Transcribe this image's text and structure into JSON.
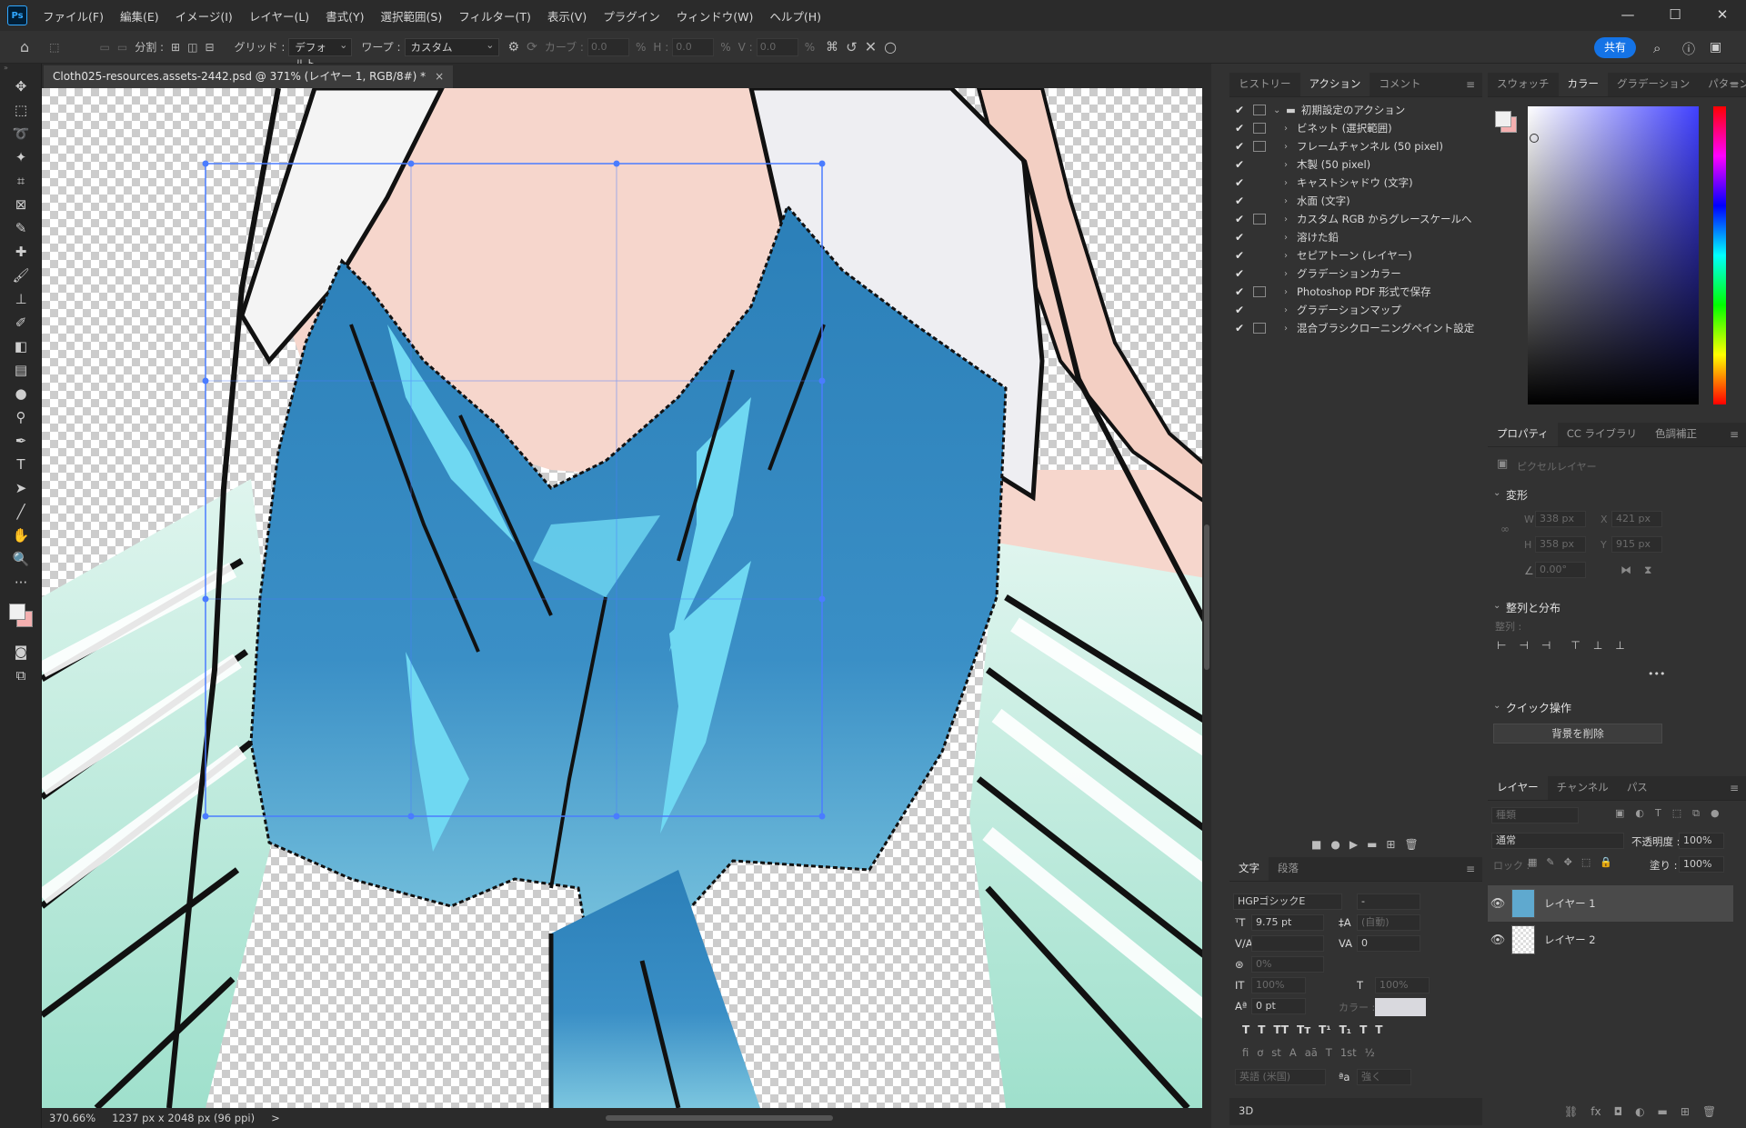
{
  "app": {
    "logo": "Ps"
  },
  "menu": [
    "ファイル(F)",
    "編集(E)",
    "イメージ(I)",
    "レイヤー(L)",
    "書式(Y)",
    "選択範囲(S)",
    "フィルター(T)",
    "表示(V)",
    "プラグイン",
    "ウィンドウ(W)",
    "ヘルプ(H)"
  ],
  "window_controls": {
    "minimize": "—",
    "maximize": "☐",
    "close": "✕"
  },
  "options": {
    "split_label": "分割 :",
    "grid_label": "グリッド :",
    "grid_value": "デフォルト",
    "warp_label": "ワープ :",
    "warp_value": "カスタム",
    "curve_label": "カーブ :",
    "curve_value": "0.0",
    "h_label": "H :",
    "h_value": "0.0",
    "v_label": "V :",
    "v_value": "0.0",
    "pct": "%",
    "share": "共有"
  },
  "document": {
    "tab_title": "Cloth025-resources.assets-2442.psd @ 371% (レイヤー 1, RGB/8#) *",
    "close": "×",
    "zoom": "370.66%",
    "info": "1237 px x 2048 px (96 ppi)",
    "arrow": ">"
  },
  "history_panel": {
    "tabs": [
      "ヒストリー",
      "アクション",
      "コメント"
    ],
    "active_tab": 1,
    "set_name": "初期設定のアクション",
    "actions": [
      {
        "label": "ビネット (選択範囲)",
        "dialog": true
      },
      {
        "label": "フレームチャンネル (50 pixel)",
        "dialog": true
      },
      {
        "label": "木製 (50 pixel)",
        "dialog": false
      },
      {
        "label": "キャストシャドウ (文字)",
        "dialog": false
      },
      {
        "label": "水面 (文字)",
        "dialog": false
      },
      {
        "label": "カスタム RGB からグレースケールへ",
        "dialog": true
      },
      {
        "label": "溶けた鉛",
        "dialog": false
      },
      {
        "label": "セピアトーン (レイヤー)",
        "dialog": false
      },
      {
        "label": "グラデーションカラー",
        "dialog": false
      },
      {
        "label": "Photoshop PDF 形式で保存",
        "dialog": true
      },
      {
        "label": "グラデーションマップ",
        "dialog": false
      },
      {
        "label": "混合ブラシクローニングペイント設定",
        "dialog": true
      }
    ]
  },
  "color_panel": {
    "tabs": [
      "スウォッチ",
      "カラー",
      "グラデーション",
      "パターン"
    ],
    "active_tab": 1
  },
  "properties_panel": {
    "tabs": [
      "プロパティ",
      "CC ライブラリ",
      "色調補正"
    ],
    "active_tab": 0,
    "layer_type": "ピクセルレイヤー",
    "transform_title": "変形",
    "w_label": "W",
    "w_value": "338 px",
    "x_label": "X",
    "x_value": "421 px",
    "h_label": "H",
    "h_value": "358 px",
    "y_label": "Y",
    "y_value": "915 px",
    "angle_value": "0.00°",
    "align_title": "整列と分布",
    "align_sub": "整列 :",
    "quick_title": "クイック操作",
    "remove_bg": "背景を削除",
    "more": "•••"
  },
  "char_panel": {
    "tabs": [
      "文字",
      "段落"
    ],
    "active_tab": 0,
    "font": "HGPゴシックE",
    "style": "-",
    "size": "9.75 pt",
    "leading": "(自動)",
    "kerning": "",
    "tracking": "0",
    "tsume": "0%",
    "vscale": "100%",
    "hscale": "100%",
    "baseline": "0 pt",
    "color_label": "カラー :",
    "language": "英語 (米国)",
    "aa_label": "ªa",
    "aa_value": "強く",
    "styles": [
      "T",
      "T",
      "TT",
      "Tт",
      "T¹",
      "T₁",
      "T",
      "T"
    ],
    "opentype": [
      "fi",
      "ơ",
      "st",
      "A",
      "aā",
      "T",
      "1st",
      "½"
    ]
  },
  "layers_panel": {
    "tabs": [
      "レイヤー",
      "チャンネル",
      "パス"
    ],
    "active_tab": 0,
    "search_placeholder": "種類",
    "blend": "通常",
    "opacity_label": "不透明度 :",
    "opacity": "100%",
    "lock_label": "ロック :",
    "fill_label": "塗り :",
    "fill": "100%",
    "layers": [
      {
        "name": "レイヤー 1",
        "selected": true
      },
      {
        "name": "レイヤー 2",
        "selected": false
      }
    ]
  },
  "panel_3d": {
    "label": "3D"
  },
  "colors": {
    "accent": "#1473e6",
    "selection": "#4a7cff"
  }
}
